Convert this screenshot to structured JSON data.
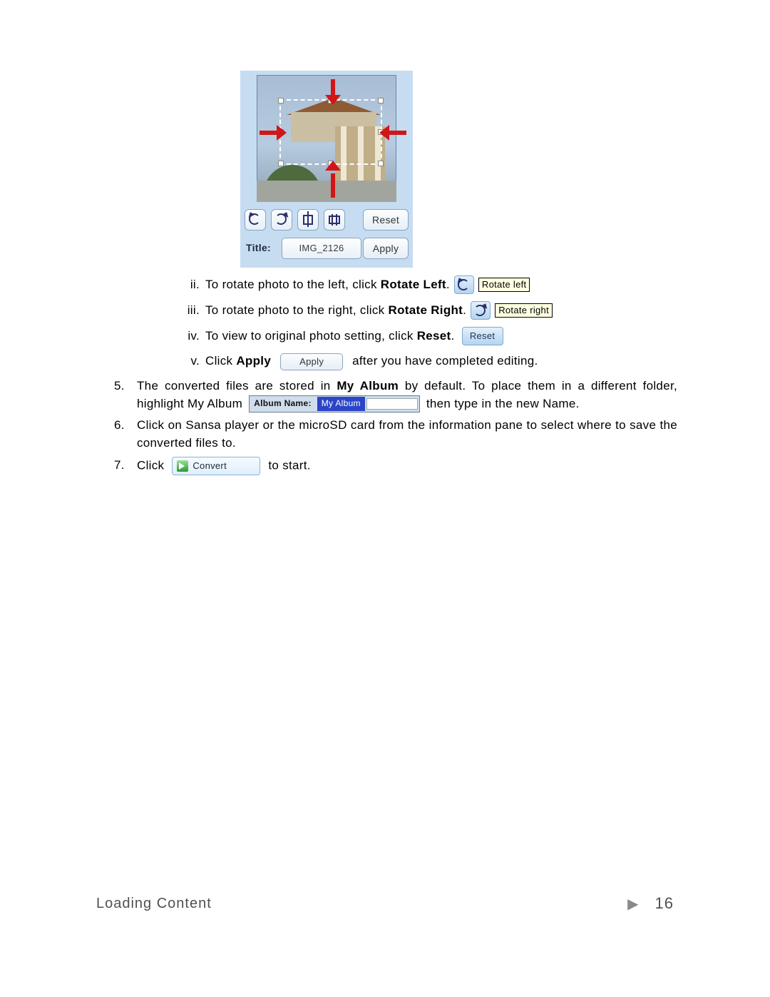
{
  "editor": {
    "title_label": "Title:",
    "title_value": "IMG_2126",
    "reset_label": "Reset",
    "apply_label": "Apply",
    "toolbar": {
      "rotate_left_icon": "rotate-left-icon",
      "rotate_right_icon": "rotate-right-icon",
      "crop_icon": "crop-icon",
      "fit_icon": "fit-to-screen-icon"
    }
  },
  "steps": {
    "ii": {
      "num": "ii.",
      "text_a": "To rotate photo to the left, click ",
      "bold": "Rotate Left",
      "text_b": "."
    },
    "iii": {
      "num": "iii.",
      "text_a": "To rotate photo to the right, click ",
      "bold": "Rotate Right",
      "text_b": "."
    },
    "iv": {
      "num": "iv.",
      "text_a": "To view to original photo setting, click ",
      "bold": "Reset",
      "text_b": "."
    },
    "v": {
      "num": "v.",
      "text_a": "Click ",
      "bold": "Apply",
      "text_b": " after you have completed editing."
    }
  },
  "tooltips": {
    "rotate_left": "Rotate left",
    "rotate_right": "Rotate right"
  },
  "inline_buttons": {
    "reset": "Reset",
    "apply": "Apply",
    "convert": "Convert"
  },
  "album": {
    "label": "Album Name:",
    "value": "My Album"
  },
  "numbered": {
    "five": {
      "n": "5.",
      "a": "The converted files are stored in ",
      "bold1": "My Album",
      "b": " by default.  To place them in a different folder, highlight My Album ",
      "c": " then type in the new Name."
    },
    "six": {
      "n": "6.",
      "text": "Click on Sansa player or the microSD card from the information pane to select where to save the converted files to."
    },
    "seven": {
      "n": "7.",
      "a": "Click ",
      "b": " to start."
    }
  },
  "footer": {
    "section": "Loading Content",
    "page": "16"
  }
}
